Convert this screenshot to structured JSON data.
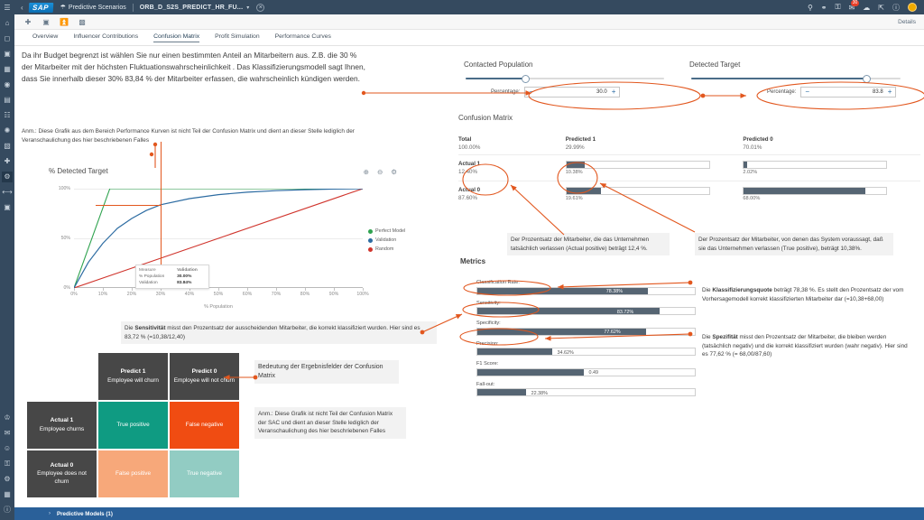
{
  "topbar": {
    "back_icon": "chevron-left-icon",
    "logo": "SAP",
    "scenario_icon": "scenario-icon",
    "scenario_label": "Predictive Scenarios",
    "document_title": "ORB_D_S2S_PREDICT_HR_FU...",
    "caret": "▾",
    "close": "×",
    "right_icons": [
      "search-icon",
      "pin-icon",
      "bulb-icon",
      "notification-icon",
      "collaboration-icon",
      "share-icon",
      "help-icon"
    ],
    "notification_count": "30"
  },
  "toolbar": {
    "icons": [
      "add-icon",
      "save-icon",
      "export-icon",
      "chart-icon"
    ],
    "details_label": "Details"
  },
  "tabs": [
    {
      "label": "Overview",
      "active": false
    },
    {
      "label": "Influencer Contributions",
      "active": false
    },
    {
      "label": "Confusion Matrix",
      "active": true
    },
    {
      "label": "Profit Simulation",
      "active": false
    },
    {
      "label": "Performance Curves",
      "active": false
    }
  ],
  "rail_icons": [
    "menu-icon",
    "home-icon",
    "file-icon",
    "presentation-icon",
    "story-icon",
    "globe-icon",
    "analytics-icon",
    "calendar-icon",
    "settings-gear-icon",
    "data-icon",
    "plus-circle-icon",
    "target-icon",
    "predictive-icon",
    "flow-icon",
    "save-disk-icon"
  ],
  "rail_bottom_icons": [
    "user-icon",
    "message-icon",
    "team-icon",
    "lock-icon",
    "gear-icon",
    "apps-icon",
    "info-icon"
  ],
  "notes": {
    "intro": "Da ihr Budget begrenzt ist wählen Sie nur einen bestimmten Anteil an Mitarbeitern aus. Z.B. die 30 % der Mitarbeiter mit der höchsten Fluktuationswahrscheinlichkeit . Das Klassifizierungsmodell sagt Ihnen, dass Sie innerhalb dieser 30% 83,84  % der Mitarbeiter erfassen, die wahrscheinlich kündigen werden.",
    "chart_disclaimer": "Anm.: Diese Grafik aus dem Bereich Performance Kurven ist nicht Teil der Confusion Matrix und dient an dieser Stelle lediglich der Veranschaulichung des hier beschriebenen Falles",
    "sensitivity_note_pre": "Die ",
    "sensitivity_note_bold": "Sensitivität",
    "sensitivity_note_post": " misst den Prozentsatz der ausscheidenden Mitarbeiter, die korrekt klassifiziert wurden. Hier sind es 83,72 % (=10,38/12,40)",
    "actual_positive_note": "Der Prozentsatz der Mitarbeiter, die das Unternehmen  tatsächlich verlassen (Actual positive) beträgt 12,4 %.",
    "true_positive_note": "Der Prozentsatz der Mitarbeiter, von denen das System voraussagt, daß sie das Unternehmen verlassen (True positive), beträgt 10,38%.",
    "classification_note_pre": "Die ",
    "classification_note_bold": "Klassifizierungsquote",
    "classification_note_post": "  beträgt 78,38 %. Es stellt den Prozentsatz der vom Vorhersagemodell korrekt klassifizierten Mitarbeiter dar (=10,38+68,00)",
    "specificity_note_pre": "Die ",
    "specificity_note_bold": "Spezifität",
    "specificity_note_post": " misst den Prozentsatz der Mitarbeiter, die bleiben werden (tatsächlich negativ) und die korrekt klassifiziert wurden (wahr negativ). Hier sind es 77,62 % (= 68,00/87,60)",
    "illus_caption": "Bedeutung der Ergebnisfelder der Confusion Matrix",
    "illus_disclaimer": "Anm.:  Diese Grafik ist nicht Teil der Confusion Matrix der SAC und dient an dieser Stelle lediglich der Veranschaulichung des hier beschriebenen Falles"
  },
  "chart_data": {
    "type": "line",
    "title": "% Detected Target",
    "xlabel": "% Population",
    "ylabel": "",
    "xlim": [
      0,
      100
    ],
    "ylim": [
      0,
      100
    ],
    "grid": true,
    "legend_position": "right",
    "xticks": [
      "0%",
      "10%",
      "20%",
      "30%",
      "40%",
      "50%",
      "60%",
      "70%",
      "80%",
      "90%",
      "100%"
    ],
    "yticks": [
      "0%",
      "50%",
      "100%"
    ],
    "series": [
      {
        "name": "Perfect Model",
        "color": "#2fa34f",
        "x": [
          0,
          12.4,
          100
        ],
        "y": [
          0,
          100,
          100
        ]
      },
      {
        "name": "Validation",
        "color": "#2d6ca2",
        "x": [
          0,
          5,
          10,
          15,
          20,
          25,
          30,
          40,
          50,
          60,
          70,
          80,
          90,
          100
        ],
        "y": [
          0,
          26,
          45,
          60,
          70,
          78,
          83.84,
          90,
          94,
          96.5,
          98,
          99,
          99.6,
          100
        ]
      },
      {
        "name": "Random",
        "color": "#d0342c",
        "x": [
          0,
          100
        ],
        "y": [
          0,
          100
        ]
      }
    ],
    "marker": {
      "x": 30,
      "y": 83.84
    },
    "tooltip": {
      "header_measure": "Measure",
      "header_value": "Validation",
      "rows": [
        {
          "label": "% Population",
          "value": "30.00%"
        },
        {
          "label": "Validation",
          "value": "83.84%"
        }
      ]
    },
    "tools": [
      "zoom-in-icon",
      "zoom-out-icon",
      "settings-gear-icon"
    ]
  },
  "sliders": [
    {
      "title": "Contacted Population",
      "knob_pct": 30,
      "percentage_label": "Percentage:",
      "value": "30.0",
      "minus": "−",
      "plus": "+"
    },
    {
      "title": "Detected Target",
      "knob_pct": 83.8,
      "percentage_label": "Percentage:",
      "value": "83.8",
      "minus": "−",
      "plus": "+"
    }
  ],
  "confusion_matrix": {
    "title": "Confusion Matrix",
    "header": [
      {
        "title": "Total",
        "value": "100.00%"
      },
      {
        "title": "Predicted 1",
        "value": "29.99%"
      },
      {
        "title": "Predicted 0",
        "value": "70.01%"
      }
    ],
    "rows": [
      {
        "label": "Actual 1",
        "total": "12.40%",
        "cells": [
          {
            "value": "10.38%",
            "pct": 10.38
          },
          {
            "value": "2.02%",
            "pct": 2.02
          }
        ]
      },
      {
        "label": "Actual 0",
        "total": "87.60%",
        "cells": [
          {
            "value": "19.61%",
            "pct": 19.61
          },
          {
            "value": "68.00%",
            "pct": 68.0
          }
        ]
      }
    ],
    "bar_scale_max": 80
  },
  "metrics": {
    "title": "Metrics",
    "items": [
      {
        "name": "Classification Rate:",
        "value": "78.38%",
        "pct": 78.38,
        "inside": true
      },
      {
        "name": "Sensitivity:",
        "value": "83.72%",
        "pct": 83.72,
        "inside": true
      },
      {
        "name": "Specificity:",
        "value": "77.62%",
        "pct": 77.62,
        "inside": true
      },
      {
        "name": "Precision:",
        "value": "34.62%",
        "pct": 34.62,
        "inside": false
      },
      {
        "name": "F1 Score:",
        "value": "0.49",
        "pct": 49.0,
        "inside": false
      },
      {
        "name": "Fall-out:",
        "value": "22.38%",
        "pct": 22.38,
        "inside": false
      }
    ]
  },
  "illustration": {
    "header": [
      {
        "title": "Predict 1",
        "sub": "Employee will churn"
      },
      {
        "title": "Predict 0",
        "sub": "Employee will not churn"
      }
    ],
    "rows": [
      {
        "title": "Actual 1",
        "sub": "Employee churns",
        "cells": [
          {
            "label": "True  positive",
            "kind": "tp"
          },
          {
            "label": "False negative",
            "kind": "fn"
          }
        ]
      },
      {
        "title": "Actual 0",
        "sub": "Employee does not churn",
        "cells": [
          {
            "label": "False positive",
            "kind": "fp"
          },
          {
            "label": "True  negative",
            "kind": "tn"
          }
        ]
      }
    ]
  },
  "bottombar": {
    "chevron": "›",
    "label": "Predictive Models (1)"
  },
  "colors": {
    "accent_orange": "#e2571e",
    "sap_navy": "#354a5f",
    "bar_gray": "#566573",
    "blue_bottom": "#2a6099"
  }
}
